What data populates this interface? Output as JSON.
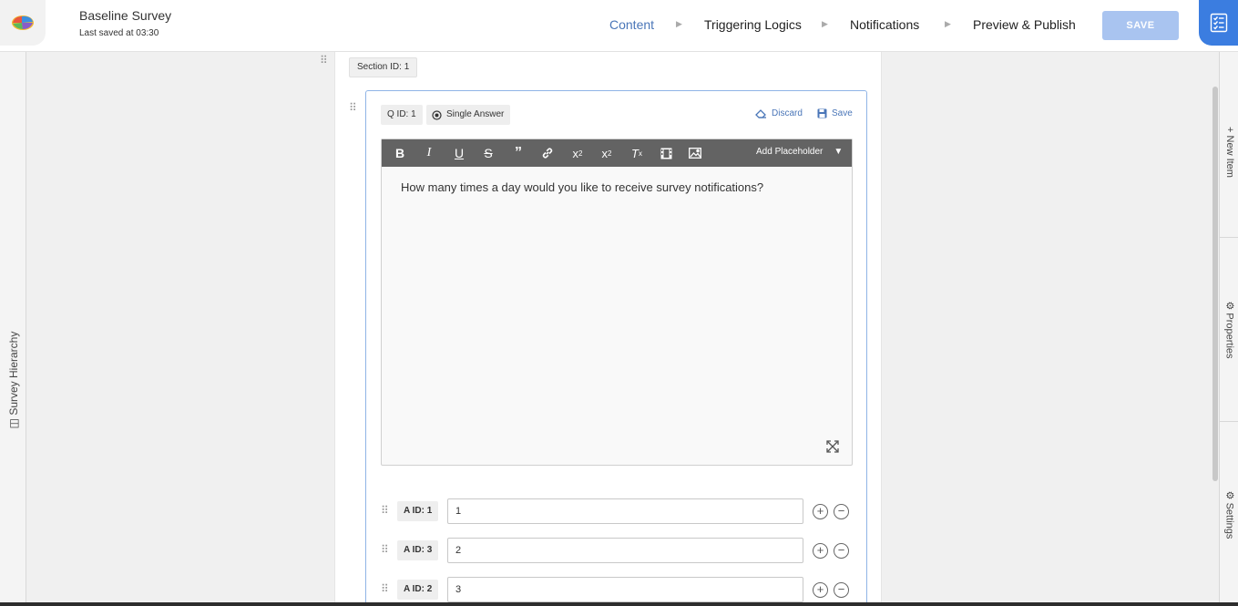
{
  "header": {
    "survey_title": "Baseline Survey",
    "last_saved": "Last saved at 03:30",
    "steps": [
      {
        "label": "Content",
        "active": true
      },
      {
        "label": "Triggering Logics",
        "active": false
      },
      {
        "label": "Notifications",
        "active": false
      },
      {
        "label": "Preview & Publish",
        "active": false
      }
    ],
    "save_label": "SAVE",
    "logo_icon": "brain-logo-icon",
    "corner_icon": "checklist-icon"
  },
  "left_rail": {
    "label": "Survey Hierarchy"
  },
  "right_rail": {
    "items": [
      {
        "label": "New Item",
        "icon": "plus-icon"
      },
      {
        "label": "Properties",
        "icon": "gear-icon"
      },
      {
        "label": "Settings",
        "icon": "gear-icon"
      }
    ]
  },
  "section": {
    "id_label": "Section ID: 1"
  },
  "question": {
    "id_label": "Q ID: 1",
    "type_label": "Single Answer",
    "discard_label": "Discard",
    "save_label": "Save",
    "toolbar": {
      "buttons": [
        "bold-icon",
        "italic-icon",
        "underline-icon",
        "strikethrough-icon",
        "quote-icon",
        "link-icon",
        "subscript-icon",
        "superscript-icon",
        "clear-format-icon",
        "video-icon",
        "image-icon"
      ],
      "placeholder_label": "Add Placeholder"
    },
    "text": "How many times a day would you like to receive survey notifications?"
  },
  "answers": [
    {
      "id_label": "A ID: 1",
      "value": "1"
    },
    {
      "id_label": "A ID: 3",
      "value": "2"
    },
    {
      "id_label": "A ID: 2",
      "value": "3"
    }
  ],
  "colors": {
    "accent": "#4a76b8",
    "save_disabled": "#a9c4f0",
    "corner": "#3b7de0",
    "toolbar": "#636363"
  }
}
